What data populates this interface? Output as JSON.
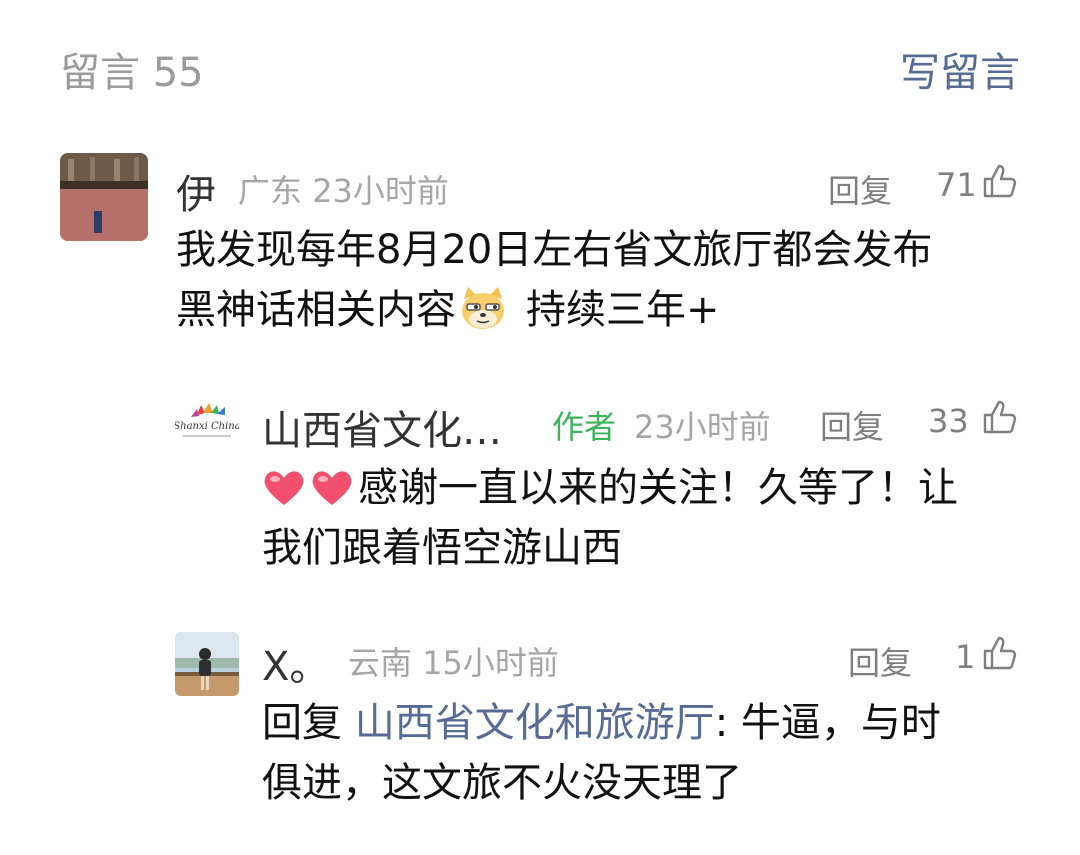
{
  "header": {
    "title": "留言 55",
    "write_label": "写留言"
  },
  "comments": [
    {
      "name": "伊",
      "location": "广东",
      "time": "23小时前",
      "reply_label": "回复",
      "likes": "71",
      "line1": "我发现每年8月20日左右省文旅厅都会发布",
      "line2a": "黑神话相关内容",
      "line2b": "持续三年+",
      "emoji": "doge-emoji"
    }
  ],
  "author_reply": {
    "name": "山西省文化…",
    "tag": "作者",
    "time": "23小时前",
    "reply_label": "回复",
    "likes": "33",
    "line1": "感谢一直以来的关注！久等了！让",
    "line2": "我们跟着悟空游山西",
    "avatar_text": "Shanxi China",
    "emoji": "heart-emoji"
  },
  "nested_reply": {
    "name": "X。",
    "location": "云南",
    "time": "15小时前",
    "reply_label": "回复",
    "likes": "1",
    "prefix": "回复",
    "quoted": "山西省文化和旅游厅",
    "line1_rest": ": 牛逼，与时",
    "line2": "俱进，这文旅不火没天理了"
  },
  "colors": {
    "link": "#576b95",
    "author_tag": "#3db35b",
    "meta": "#a6a6a6"
  }
}
